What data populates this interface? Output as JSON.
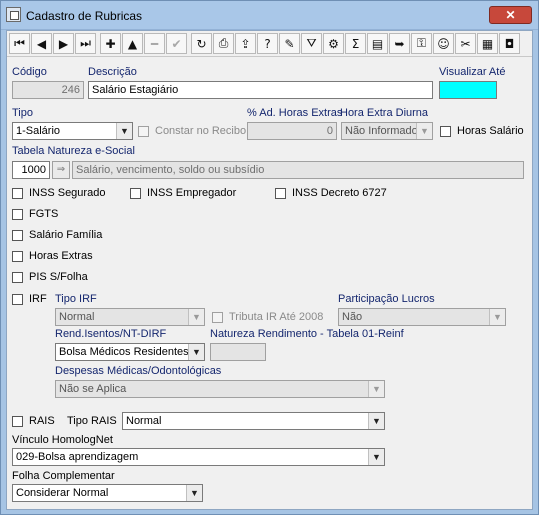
{
  "window": {
    "title": "Cadastro de Rubricas",
    "close": "✕"
  },
  "toolbar": [
    {
      "name": "first-record-button",
      "glyph": "⏮",
      "enabled": true
    },
    {
      "name": "previous-record-button",
      "glyph": "◀",
      "enabled": true
    },
    {
      "name": "next-record-button",
      "glyph": "▶",
      "enabled": true
    },
    {
      "name": "last-record-button",
      "glyph": "⏭",
      "enabled": true
    },
    {
      "name": "insert-button",
      "glyph": "✚",
      "enabled": true
    },
    {
      "name": "delete-button",
      "glyph": "▲",
      "enabled": true
    },
    {
      "name": "cancel-edit-button",
      "glyph": "━",
      "enabled": false
    },
    {
      "name": "post-button",
      "glyph": "✔",
      "enabled": false
    },
    {
      "name": "refresh-button",
      "glyph": "↻",
      "enabled": true
    },
    {
      "name": "print-button",
      "glyph": "⎙",
      "enabled": true
    },
    {
      "name": "export-button",
      "glyph": "⇪",
      "enabled": true
    },
    {
      "name": "help-button",
      "glyph": "?",
      "enabled": true
    },
    {
      "name": "formula-button",
      "glyph": "✎",
      "enabled": true
    },
    {
      "name": "filter-button",
      "glyph": "⛛",
      "enabled": true
    },
    {
      "name": "query-button",
      "glyph": "⚙",
      "enabled": true
    },
    {
      "name": "sum-button",
      "glyph": "Σ",
      "enabled": true
    },
    {
      "name": "report-button",
      "glyph": "▤",
      "enabled": true
    },
    {
      "name": "exit-button",
      "glyph": "➥",
      "enabled": true
    },
    {
      "name": "key-button",
      "glyph": "⚿",
      "enabled": true
    },
    {
      "name": "users-button",
      "glyph": "☺",
      "enabled": true
    },
    {
      "name": "setup-button",
      "glyph": "✂",
      "enabled": true
    },
    {
      "name": "calendar-button",
      "glyph": "▦",
      "enabled": true
    },
    {
      "name": "close-form-button",
      "glyph": "◘",
      "enabled": true
    }
  ],
  "form": {
    "codigo_label": "Código",
    "codigo_value": "246",
    "descricao_label": "Descrição",
    "descricao_value": "Salário Estagiário",
    "visualizar_label": "Visualizar Até",
    "visualizar_value": "",
    "tipo_label": "Tipo",
    "tipo_value": "1-Salário",
    "constar_label": "Constar no Recibo",
    "pct_label": "% Ad. Horas Extras",
    "pct_value": "0",
    "hora_extra_label": "Hora Extra Diurna",
    "hora_extra_value": "Não Informado",
    "horas_salario_label": "Horas Salário",
    "tabela_label": "Tabela Natureza e-Social",
    "tabela_code": "1000",
    "tabela_desc": "Salário, vencimento, soldo ou subsídio",
    "lookup_glyph": "⇒",
    "inss_segurado": "INSS Segurado",
    "inss_empregador": "INSS Empregador",
    "inss_decreto": "INSS Decreto 6727",
    "fgts": "FGTS",
    "salario_familia": "Salário Família",
    "horas_extras": "Horas Extras",
    "pis": "PIS S/Folha",
    "irf": "IRF",
    "tipo_irf_label": "Tipo IRF",
    "tipo_irf_value": "Normal",
    "tributa_label": "Tributa IR Até 2008",
    "participacao_label": "Participação Lucros",
    "participacao_value": "Não",
    "rend_label": "Rend.Isentos/NT-DIRF",
    "rend_value": "Bolsa Médicos Residentes",
    "natureza_label": "Natureza Rendimento - Tabela 01-Reinf",
    "natureza_value": "",
    "despesas_label": "Despesas Médicas/Odontológicas",
    "despesas_value": "Não se Aplica",
    "rais": "RAIS",
    "tipo_rais_label": "Tipo RAIS",
    "tipo_rais_value": "Normal",
    "vinculo_label": "Vínculo HomologNet",
    "vinculo_value": "029-Bolsa aprendizagem",
    "folha_label": "Folha Complementar",
    "folha_value": "Considerar Normal",
    "arrow": "▼"
  }
}
